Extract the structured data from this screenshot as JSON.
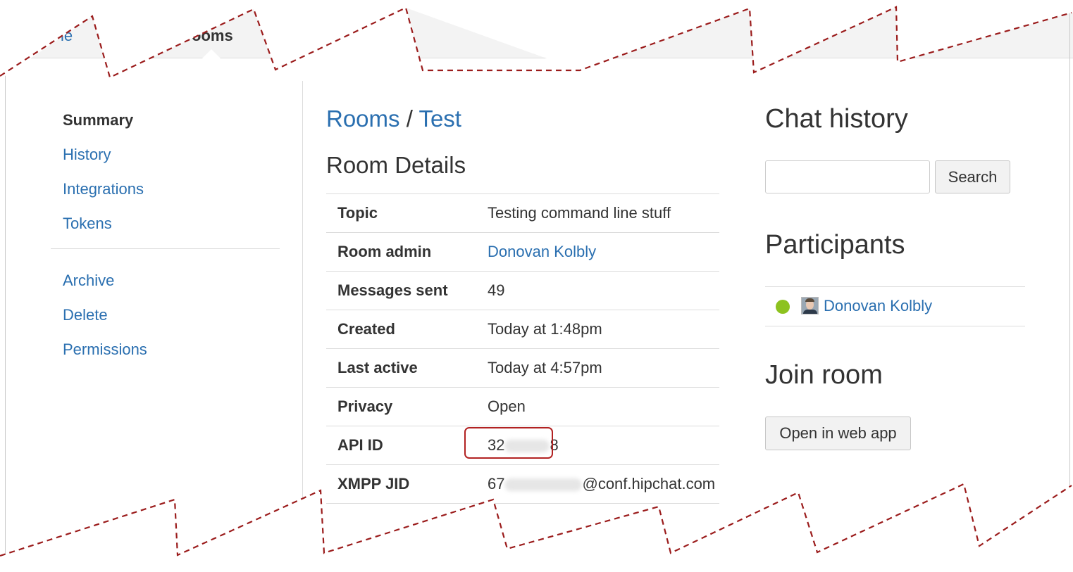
{
  "topnav": {
    "items": [
      {
        "label": "ie"
      },
      {
        "label": "ooms"
      }
    ]
  },
  "sidebar": {
    "primary": [
      {
        "label": "Summary"
      },
      {
        "label": "History"
      },
      {
        "label": "Integrations"
      },
      {
        "label": "Tokens"
      }
    ],
    "secondary": [
      {
        "label": "Archive"
      },
      {
        "label": "Delete"
      },
      {
        "label": "Permissions"
      }
    ]
  },
  "breadcrumb": {
    "rooms": "Rooms",
    "sep": "/",
    "room": "Test"
  },
  "room_details": {
    "title": "Room Details",
    "topic": {
      "label": "Topic",
      "value": "Testing command line stuff"
    },
    "admin": {
      "label": "Room admin",
      "value": "Donovan Kolbly"
    },
    "messages": {
      "label": "Messages sent",
      "value": "49"
    },
    "created": {
      "label": "Created",
      "value": "Today at 1:48pm"
    },
    "last_active": {
      "label": "Last active",
      "value": "Today at 4:57pm"
    },
    "privacy": {
      "label": "Privacy",
      "value": "Open"
    },
    "api_id": {
      "label": "API ID",
      "prefix": "32",
      "suffix": "8"
    },
    "xmpp": {
      "label": "XMPP JID",
      "prefix": "67",
      "suffix": "@conf.hipchat.com"
    }
  },
  "chat_history": {
    "title": "Chat history",
    "search_value": "",
    "search_button": "Search"
  },
  "participants": {
    "title": "Participants",
    "list": [
      {
        "name": "Donovan Kolbly",
        "status_color": "#8dc21f"
      }
    ]
  },
  "join_room": {
    "title": "Join room",
    "button": "Open in web app"
  },
  "colors": {
    "link": "#2a6fb0",
    "highlight": "#b22222",
    "torn_edge": "#9b1c1c"
  }
}
